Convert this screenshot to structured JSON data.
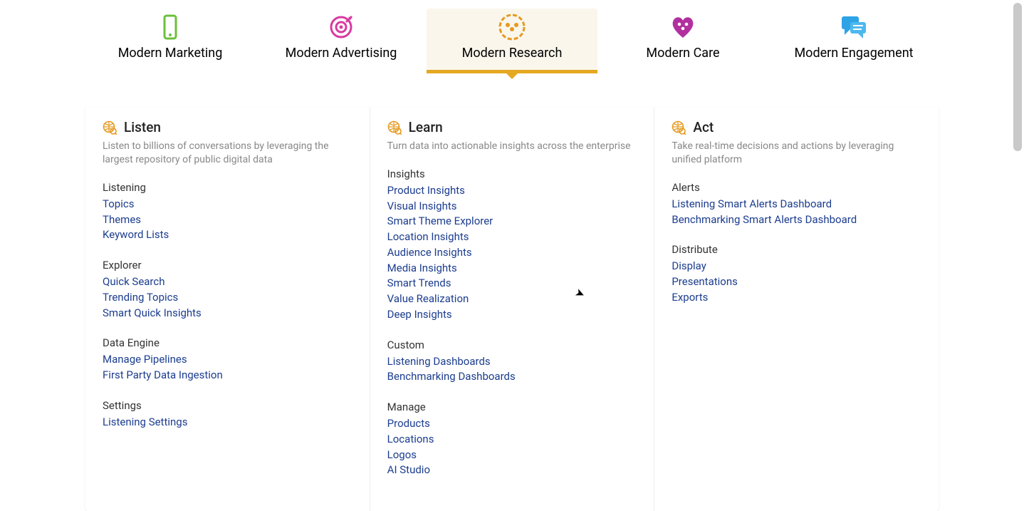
{
  "tabs": [
    {
      "label": "Modern Marketing",
      "active": false,
      "icon": "phone-icon",
      "color": "#6cbf3a"
    },
    {
      "label": "Modern Advertising",
      "active": false,
      "icon": "target-icon",
      "color": "#d83aa0"
    },
    {
      "label": "Modern Research",
      "active": true,
      "icon": "people-icon",
      "color": "#e59a1f"
    },
    {
      "label": "Modern Care",
      "active": false,
      "icon": "heart-icon",
      "color": "#b1309e"
    },
    {
      "label": "Modern Engagement",
      "active": false,
      "icon": "chat-icon",
      "color": "#2ea3e6"
    }
  ],
  "columns": [
    {
      "title": "Listen",
      "desc": "Listen to billions of conversations by leveraging the largest repository of public digital data",
      "groups": [
        {
          "title": "Listening",
          "links": [
            "Topics",
            "Themes",
            "Keyword Lists"
          ]
        },
        {
          "title": "Explorer",
          "links": [
            "Quick Search",
            "Trending Topics",
            "Smart Quick Insights"
          ]
        },
        {
          "title": "Data Engine",
          "links": [
            "Manage Pipelines",
            "First Party Data Ingestion"
          ]
        },
        {
          "title": "Settings",
          "links": [
            "Listening Settings"
          ]
        }
      ]
    },
    {
      "title": "Learn",
      "desc": "Turn data into actionable insights across the enterprise",
      "groups": [
        {
          "title": "Insights",
          "links": [
            "Product Insights",
            "Visual Insights",
            "Smart Theme Explorer",
            "Location Insights",
            "Audience Insights",
            "Media Insights",
            "Smart Trends",
            "Value Realization",
            "Deep Insights"
          ]
        },
        {
          "title": "Custom",
          "links": [
            "Listening Dashboards",
            "Benchmarking Dashboards"
          ]
        },
        {
          "title": "Manage",
          "links": [
            "Products",
            "Locations",
            "Logos",
            "AI Studio"
          ]
        }
      ]
    },
    {
      "title": "Act",
      "desc": "Take real-time decisions and actions by leveraging unified platform",
      "groups": [
        {
          "title": "Alerts",
          "links": [
            "Listening Smart Alerts Dashboard",
            "Benchmarking Smart Alerts Dashboard"
          ]
        },
        {
          "title": "Distribute",
          "links": [
            "Display",
            "Presentations",
            "Exports"
          ]
        }
      ]
    }
  ]
}
